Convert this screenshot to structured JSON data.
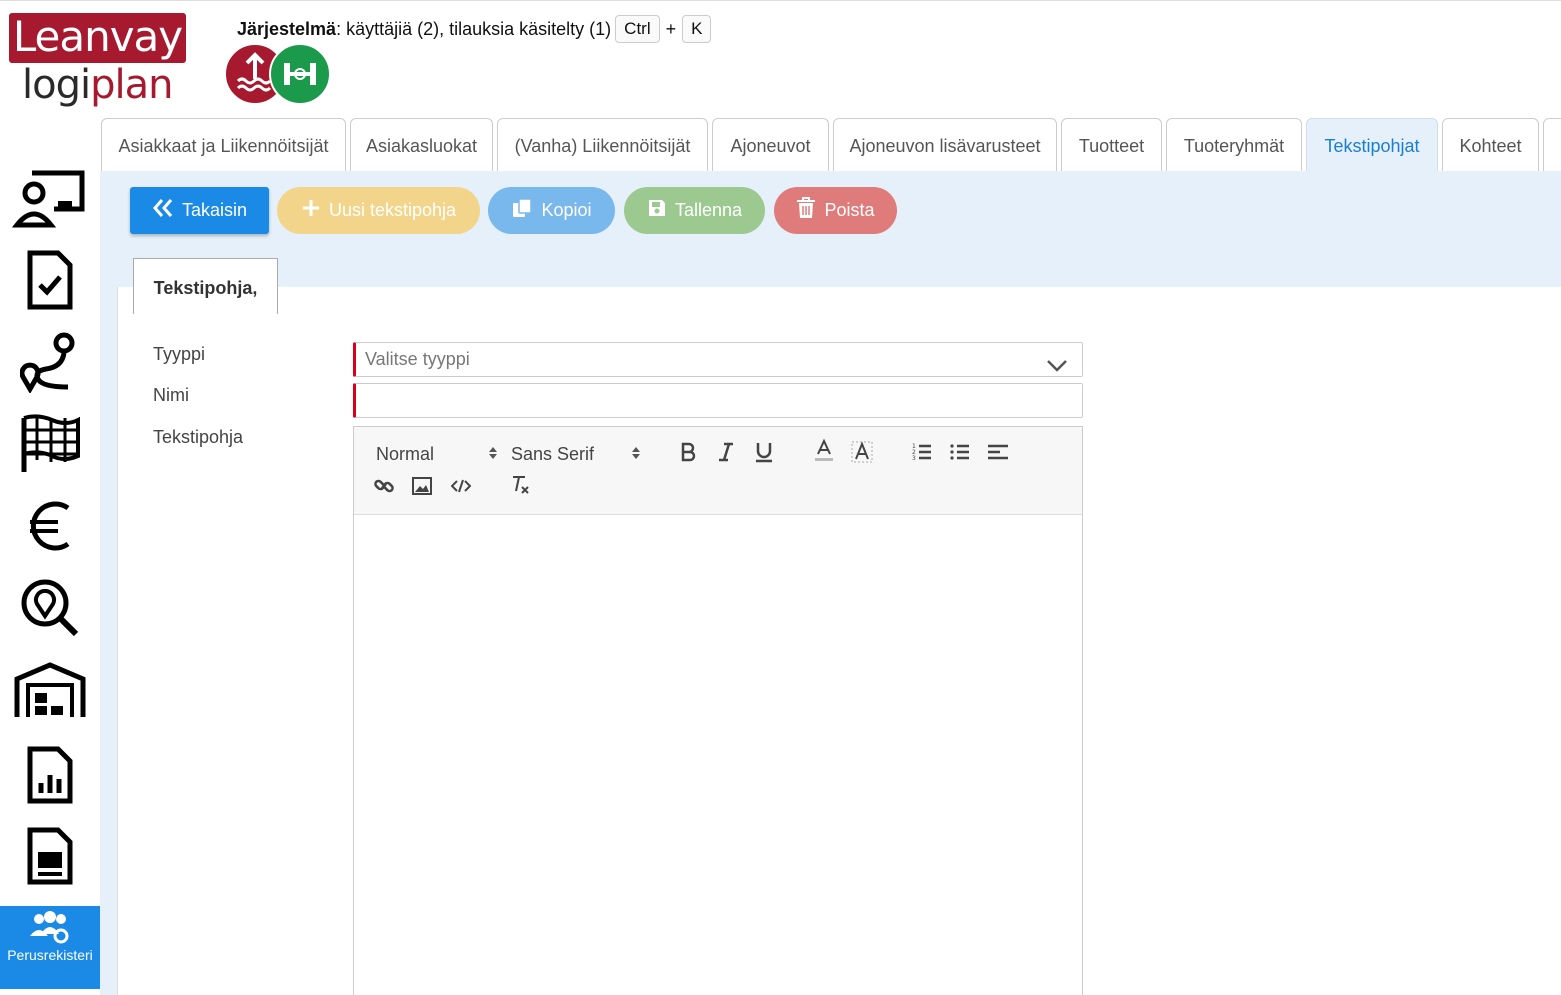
{
  "header": {
    "logo_top": "Leanvay",
    "logo_bottom_a": "logi",
    "logo_bottom_b": "plan",
    "system_label": "Järjestelmä",
    "system_text": ": käyttäjiä (2), tilauksia käsitelty (1)",
    "shortcut_key1": "Ctrl",
    "shortcut_plus": "+",
    "shortcut_key2": "K"
  },
  "sidebar": {
    "items": [
      {
        "icon": "dispatch-icon"
      },
      {
        "icon": "document-check-icon"
      },
      {
        "icon": "route-icon"
      },
      {
        "icon": "checkered-flag-icon"
      },
      {
        "icon": "euro-icon"
      },
      {
        "icon": "location-search-icon"
      },
      {
        "icon": "warehouse-icon"
      },
      {
        "icon": "report-icon"
      },
      {
        "icon": "document-icon"
      }
    ],
    "active_label": "Perusrekisteri"
  },
  "tabs": [
    {
      "label": "Asiakkaat ja Liikennöitsijät"
    },
    {
      "label": "Asiakasluokat"
    },
    {
      "label": "(Vanha) Liikennöitsijät"
    },
    {
      "label": "Ajoneuvot"
    },
    {
      "label": "Ajoneuvon lisävarusteet"
    },
    {
      "label": "Tuotteet"
    },
    {
      "label": "Tuoteryhmät"
    },
    {
      "label": "Tekstipohjat"
    },
    {
      "label": "Kohteet"
    }
  ],
  "active_tab": "Tekstipohjat",
  "actions": {
    "back": "Takaisin",
    "new": "Uusi tekstipohja",
    "copy": "Kopioi",
    "save": "Tallenna",
    "delete": "Poista"
  },
  "form": {
    "subtab": "Tekstipohja,",
    "type_label": "Tyyppi",
    "type_placeholder": "Valitse tyyppi",
    "name_label": "Nimi",
    "name_value": "",
    "template_label": "Tekstipohja"
  },
  "editor": {
    "heading_select": "Normal",
    "font_select": "Sans Serif"
  },
  "colors": {
    "brand": "#a6192e",
    "accent": "#1a8ae6",
    "panel": "#e5f0fa",
    "required": "#d9001b"
  }
}
